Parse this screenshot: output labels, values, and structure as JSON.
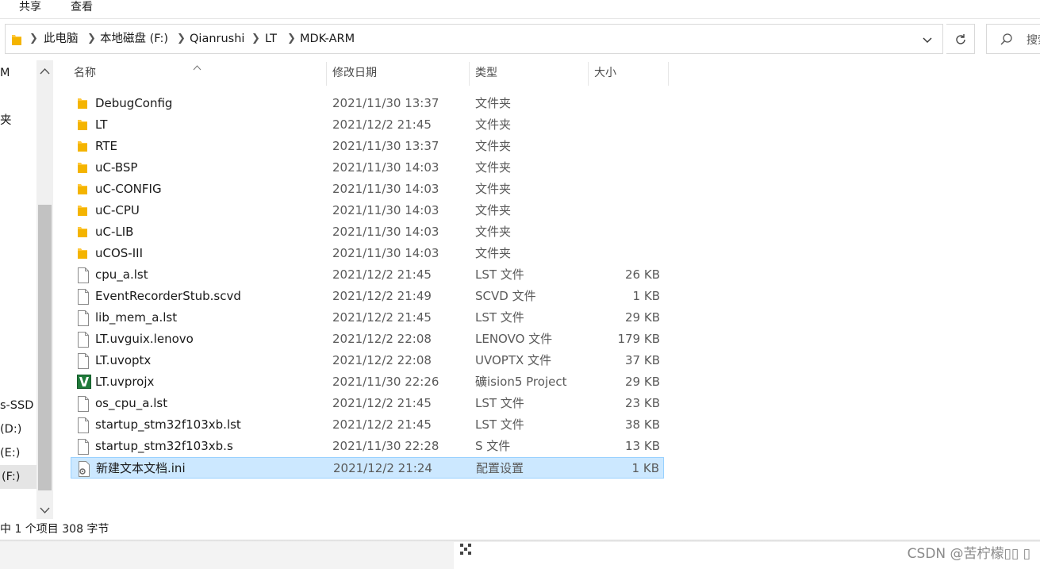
{
  "ribbon": {
    "tabs": [
      "共享",
      "查看"
    ]
  },
  "address": {
    "crumbs": [
      "此电脑",
      "本地磁盘 (F:)",
      "Qianrushi",
      "LT",
      "MDK-ARM"
    ],
    "search_placeholder": "搜索"
  },
  "nav": {
    "items": [
      "M",
      "夹",
      "s-SSD (",
      "(D:)",
      "(E:)",
      "(F:)"
    ]
  },
  "columns": {
    "name": "名称",
    "date": "修改日期",
    "type": "类型",
    "size": "大小"
  },
  "files": [
    {
      "name": "DebugConfig",
      "date": "2021/11/30 13:37",
      "type": "文件夹",
      "size": "",
      "icon": "folder-icon"
    },
    {
      "name": "LT",
      "date": "2021/12/2 21:45",
      "type": "文件夹",
      "size": "",
      "icon": "folder-icon"
    },
    {
      "name": "RTE",
      "date": "2021/11/30 13:37",
      "type": "文件夹",
      "size": "",
      "icon": "folder-icon"
    },
    {
      "name": "uC-BSP",
      "date": "2021/11/30 14:03",
      "type": "文件夹",
      "size": "",
      "icon": "folder-icon"
    },
    {
      "name": "uC-CONFIG",
      "date": "2021/11/30 14:03",
      "type": "文件夹",
      "size": "",
      "icon": "folder-icon"
    },
    {
      "name": "uC-CPU",
      "date": "2021/11/30 14:03",
      "type": "文件夹",
      "size": "",
      "icon": "folder-icon"
    },
    {
      "name": "uC-LIB",
      "date": "2021/11/30 14:03",
      "type": "文件夹",
      "size": "",
      "icon": "folder-icon"
    },
    {
      "name": "uCOS-III",
      "date": "2021/11/30 14:03",
      "type": "文件夹",
      "size": "",
      "icon": "folder-icon"
    },
    {
      "name": "cpu_a.lst",
      "date": "2021/12/2 21:45",
      "type": "LST 文件",
      "size": "26 KB",
      "icon": "file-icon"
    },
    {
      "name": "EventRecorderStub.scvd",
      "date": "2021/12/2 21:49",
      "type": "SCVD 文件",
      "size": "1 KB",
      "icon": "file-icon"
    },
    {
      "name": "lib_mem_a.lst",
      "date": "2021/12/2 21:45",
      "type": "LST 文件",
      "size": "29 KB",
      "icon": "file-icon"
    },
    {
      "name": "LT.uvguix.lenovo",
      "date": "2021/12/2 22:08",
      "type": "LENOVO 文件",
      "size": "179 KB",
      "icon": "file-icon"
    },
    {
      "name": "LT.uvoptx",
      "date": "2021/12/2 22:08",
      "type": "UVOPTX 文件",
      "size": "37 KB",
      "icon": "file-icon"
    },
    {
      "name": "LT.uvprojx",
      "date": "2021/11/30 22:26",
      "type": "礦ision5 Project",
      "size": "29 KB",
      "icon": "uvision-project-icon"
    },
    {
      "name": "os_cpu_a.lst",
      "date": "2021/12/2 21:45",
      "type": "LST 文件",
      "size": "23 KB",
      "icon": "file-icon"
    },
    {
      "name": "startup_stm32f103xb.lst",
      "date": "2021/12/2 21:45",
      "type": "LST 文件",
      "size": "38 KB",
      "icon": "file-icon"
    },
    {
      "name": "startup_stm32f103xb.s",
      "date": "2021/11/30 22:28",
      "type": "S 文件",
      "size": "13 KB",
      "icon": "file-icon"
    },
    {
      "name": "新建文本文档.ini",
      "date": "2021/12/2 21:24",
      "type": "配置设置",
      "size": "1 KB",
      "icon": "settings-file-icon",
      "selected": true
    }
  ],
  "status": {
    "text": "中 1 个项目  308 字节"
  },
  "watermark": "CSDN @苦柠檬▯▯ ▯",
  "colors": {
    "selection": "#cce8ff",
    "selection_border": "#99d1ff",
    "folder": "#ffc83d"
  }
}
